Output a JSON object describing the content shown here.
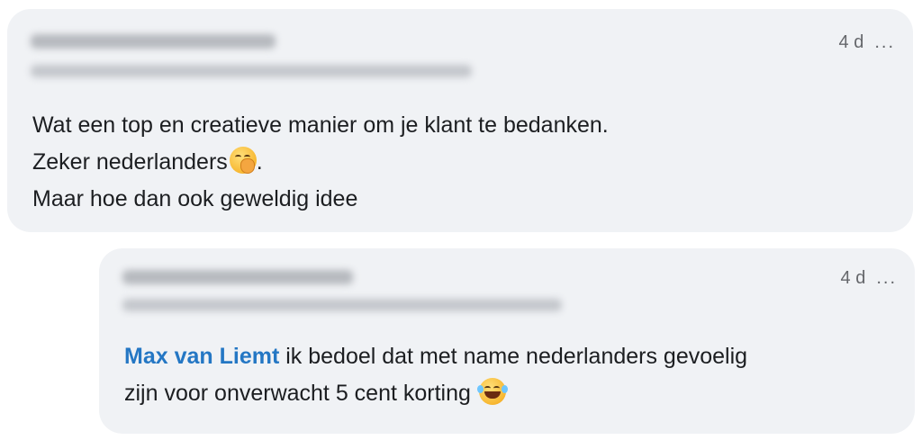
{
  "comments": [
    {
      "time": "4 d",
      "more": "...",
      "lines": [
        "Wat een top en creatieve manier om je klant te bedanken.",
        "Zeker nederlanders",
        ".",
        "Maar hoe dan ook geweldig idee"
      ],
      "emoji": "face-with-hand-over-mouth-icon"
    },
    {
      "time": "4 d",
      "more": "...",
      "mention": "Max van Liemt",
      "lines": [
        " ik bedoel dat met name nederlanders gevoelig",
        "zijn voor onverwacht 5 cent korting "
      ],
      "emoji": "face-with-tears-of-joy-icon"
    }
  ],
  "colors": {
    "bubble": "#f0f2f5",
    "text": "#1c1e21",
    "meta": "#65676b",
    "mention": "#2477c4"
  }
}
